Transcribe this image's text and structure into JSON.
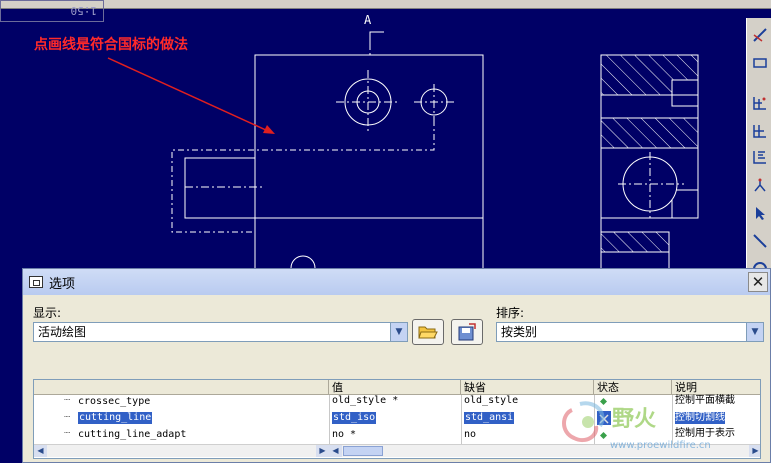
{
  "viewport": {
    "scale_label": "1:50",
    "annotation": "点画线是符合国标的做法",
    "section_marker": "A",
    "colors": {
      "background": "#000066",
      "drawing_lines": "#ffffff",
      "annotation": "#ff2a2a",
      "arrow": "#e01f1f"
    }
  },
  "right_toolbar": {
    "icons": [
      "datum-axis-icon",
      "grid-table-icon",
      "table-icon",
      "format-icon",
      "branch-icon",
      "select-arrow-icon",
      "line-icon",
      "circle-icon"
    ]
  },
  "dialog": {
    "title": "选项",
    "display_label": "显示:",
    "display_value": "活动绘图",
    "sort_label": "排序:",
    "sort_value": "按类别",
    "open_icon": "folder-open-icon",
    "save_icon": "save-config-icon",
    "columns": [
      "值",
      "缺省",
      "状态",
      "说明"
    ],
    "rows": [
      {
        "name": "crossec_type",
        "value": "old_style *",
        "default": "old_style",
        "description": "控制平面横截",
        "selected": false
      },
      {
        "name": "cutting_line",
        "value": "std_iso",
        "default": "std_ansi",
        "description": "控制切割线",
        "selected": true
      },
      {
        "name": "cutting_line_adapt",
        "value": "no *",
        "default": "no",
        "description": "控制用于表示",
        "selected": false
      }
    ]
  },
  "watermark": {
    "text": "野火",
    "url": "www.proewildfire.cn"
  }
}
